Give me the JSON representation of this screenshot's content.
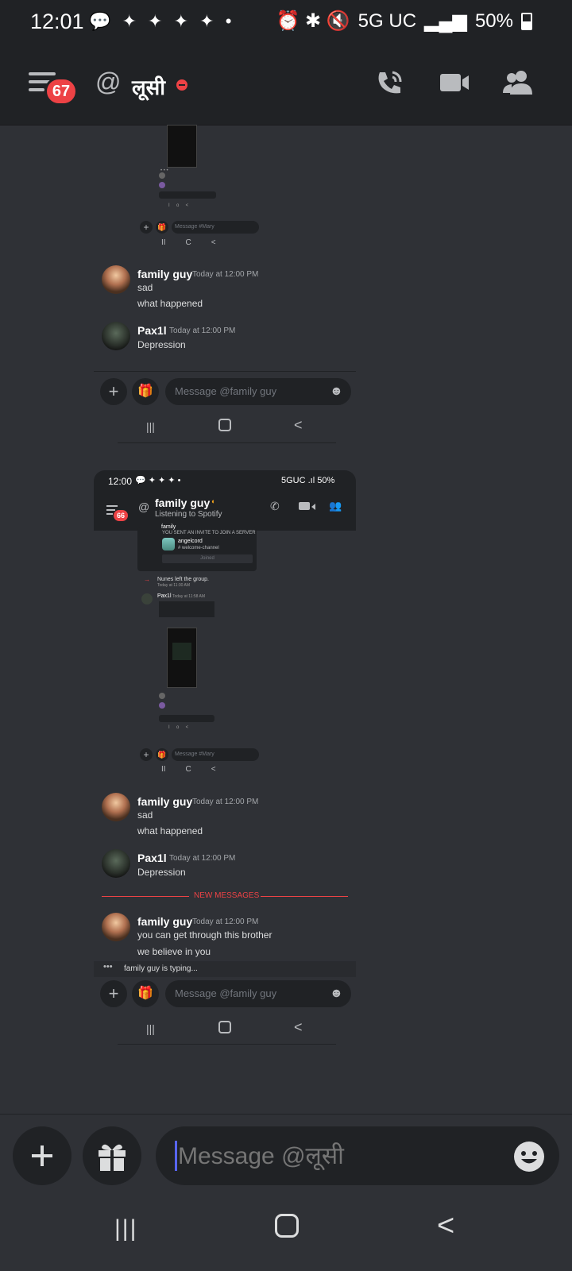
{
  "status": {
    "time": "12:01",
    "network": "5G UC",
    "battery": "50%",
    "notif": "💬 ✦ ✦ ✦ ✦ •",
    "icons": "⏰ ✱ 🔇"
  },
  "header": {
    "badge": "67",
    "at": "@",
    "title": "लूसी",
    "call_icon": "phone-icon",
    "video_icon": "video-icon",
    "members_icon": "members-icon"
  },
  "shot1": {
    "messages": [
      {
        "user": "family guy",
        "time": "Today at 12:00 PM",
        "lines": [
          "sad",
          "what happened"
        ]
      },
      {
        "user": "Pax1l",
        "time": "Today at 12:00 PM",
        "lines": [
          "Depression"
        ]
      }
    ],
    "input_placeholder": "Message @family guy",
    "mini_input": "Message #Mary"
  },
  "shot2": {
    "status_time": "12:00",
    "status_right": "5GUC .ıl 50%",
    "badge": "66",
    "title": "family guy",
    "subtitle": "Listening to Spotify",
    "invite_text": "YOU SENT AN INVITE TO JOIN A SERVER",
    "server_name": "angelcord",
    "channel": "# welcome-channel",
    "join_label": "Joined",
    "left_group": "Nunes left the group.",
    "left_time": "Today at 11:30 AM",
    "pax_mini": "Pax1l",
    "mini_input": "Message #Mary",
    "messages": [
      {
        "user": "family guy",
        "time": "Today at 12:00 PM",
        "lines": [
          "sad",
          "what happened"
        ]
      },
      {
        "user": "Pax1l",
        "time": "Today at 12:00 PM",
        "lines": [
          "Depression"
        ]
      }
    ],
    "new_messages": "NEW MESSAGES",
    "new_msg": {
      "user": "family guy",
      "time": "Today at 12:00 PM",
      "lines": [
        "you can get through this brother",
        "we believe in you"
      ]
    },
    "typing": "family guy is typing...",
    "input_placeholder": "Message @family guy"
  },
  "composer": {
    "placeholder": "Message @लूसी"
  },
  "nav": {
    "recents": "|||",
    "home": "○",
    "back": "<"
  }
}
